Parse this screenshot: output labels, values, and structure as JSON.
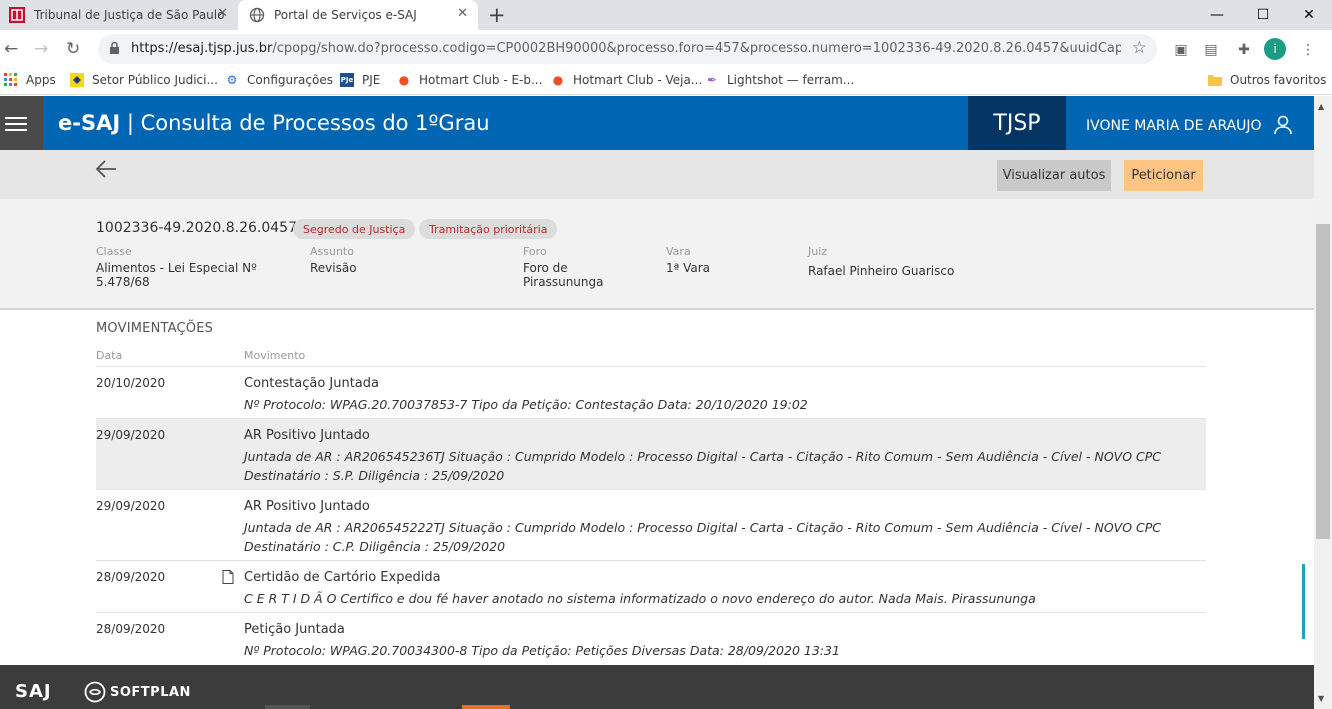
{
  "browser": {
    "tabs": [
      {
        "title": "Tribunal de Justiça de São Paulo",
        "active": false
      },
      {
        "title": "Portal de Serviços e-SAJ",
        "active": true
      }
    ],
    "url_host": "https://esaj.tjsp.jus.br",
    "url_path": "/cpopg/show.do?processo.codigo=CP0002BH90000&processo.foro=457&processo.numero=1002336-49.2020.8.26.0457&uuidCaptcha=...",
    "profile_initial": "i",
    "bookmarks": [
      {
        "label": "Apps",
        "icon": "apps-grid-icon"
      },
      {
        "label": "Setor Público Judici...",
        "icon": "bb-icon"
      },
      {
        "label": "Configurações",
        "icon": "gear-icon"
      },
      {
        "label": "PJE",
        "icon": "pje-icon"
      },
      {
        "label": "Hotmart Club - E-b...",
        "icon": "hotmart-icon"
      },
      {
        "label": "Hotmart Club - Veja...",
        "icon": "hotmart-icon"
      },
      {
        "label": "Lightshot — ferram...",
        "icon": "lightshot-icon"
      }
    ],
    "other_bookmarks": "Outros favoritos"
  },
  "header": {
    "brand_bold": "e-SAJ",
    "brand_rest": " | Consulta de Processos do 1ºGrau",
    "court": "TJSP",
    "user": "IVONE MARIA DE ARAUJO"
  },
  "actions": {
    "view": "Visualizar autos",
    "petition": "Peticionar"
  },
  "process": {
    "number": "1002336-49.2020.8.26.0457",
    "badges": [
      "Segredo de Justiça",
      "Tramitação prioritária"
    ],
    "fields": [
      {
        "label": "Classe",
        "value": "Alimentos - Lei Especial Nº 5.478/68"
      },
      {
        "label": "Assunto",
        "value": "Revisão"
      },
      {
        "label": "Foro",
        "value": "Foro de Pirassununga"
      },
      {
        "label": "Vara",
        "value": "1ª Vara"
      },
      {
        "label": "Juiz",
        "value": "Rafael Pinheiro Guarisco"
      }
    ]
  },
  "movimentacoes": {
    "title": "MOVIMENTAÇÕES",
    "col_date": "Data",
    "col_movement": "Movimento",
    "rows": [
      {
        "date": "20/10/2020",
        "title": "Contestação Juntada",
        "desc1": "Nº Protocolo: WPAG.20.70037853-7 Tipo da Petição: Contestação Data: 20/10/2020 19:02",
        "desc2": ""
      },
      {
        "date": "29/09/2020",
        "title": "AR Positivo Juntado",
        "desc1": "Juntada de AR : AR206545236TJ Situação : Cumprido Modelo : Processo Digital - Carta - Citação - Rito Comum - Sem Audiência - Cível - NOVO CPC",
        "desc2": "Destinatário : S.P. Diligência : 25/09/2020"
      },
      {
        "date": "29/09/2020",
        "title": "AR Positivo Juntado",
        "desc1": "Juntada de AR : AR206545222TJ Situação : Cumprido Modelo : Processo Digital - Carta - Citação - Rito Comum - Sem Audiência - Cível - NOVO CPC",
        "desc2": "Destinatário : C.P. Diligência : 25/09/2020"
      },
      {
        "date": "28/09/2020",
        "title": "Certidão de Cartório Expedida",
        "desc1": "C E R T I D Ã O Certifico e dou fé haver anotado no sistema informatizado o novo endereço do autor. Nada Mais. Pirassununga",
        "desc2": ""
      },
      {
        "date": "28/09/2020",
        "title": "Petição Juntada",
        "desc1": "Nº Protocolo: WPAG.20.70034300-8 Tipo da Petição: Petições Diversas Data: 28/09/2020 13:31",
        "desc2": ""
      }
    ]
  },
  "footer": {
    "saj": "SAJ",
    "softplan": "SOFTPLAN"
  },
  "colors": {
    "header_blue": "#0066b3",
    "tjsp_navy": "#053563",
    "peticionar_orange": "#fdc482",
    "badge_red": "#c0272d",
    "footer_dark": "#3c3c3c"
  }
}
